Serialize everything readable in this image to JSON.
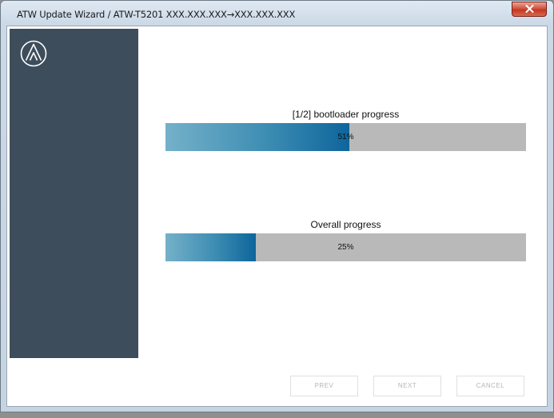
{
  "window": {
    "title": "ATW Update Wizard / ATW-T5201 XXX.XXX.XXX→XXX.XXX.XXX"
  },
  "title_controls": {
    "close_icon": "close-icon"
  },
  "sidebar": {
    "logo_icon": "audio-technica-logo-icon",
    "color": "#3e4d5c"
  },
  "progress": {
    "bootloader": {
      "label": "[1/2] bootloader progress",
      "value_text": "51%",
      "fraction": 0.51
    },
    "overall": {
      "label": "Overall progress",
      "value_text": "25%",
      "fraction": 0.25
    }
  },
  "buttons": {
    "prev_label": "PREV",
    "next_label": "NEXT",
    "cancel_label": "CANCEL"
  },
  "colors": {
    "progress_fill_start": "#75b1c9",
    "progress_fill_end": "#0e659c",
    "progress_track": "#b9b9b9",
    "close_button": "#c23822"
  }
}
